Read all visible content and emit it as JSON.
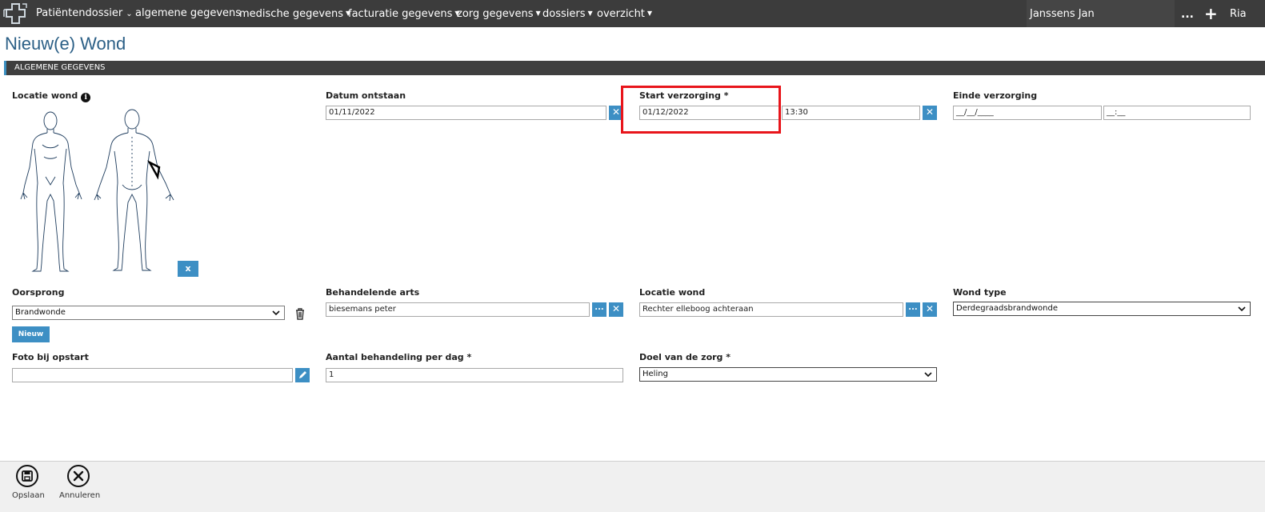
{
  "nav": {
    "brand": "Patiëntendossier",
    "items": [
      {
        "label": "algemene gegevens",
        "dropdown": false
      },
      {
        "label": "medische gegevens",
        "dropdown": true
      },
      {
        "label": "facturatie gegevens",
        "dropdown": true
      },
      {
        "label": "zorg gegevens",
        "dropdown": true
      },
      {
        "label": "dossiers",
        "dropdown": true
      },
      {
        "label": "overzicht",
        "dropdown": true
      }
    ],
    "patient_name": "Janssens Jan",
    "more_label": "...",
    "add_label": "+",
    "user": "Ria"
  },
  "page": {
    "title": "Nieuw(e) Wond",
    "section": "ALGEMENE GEGEVENS"
  },
  "form": {
    "locatie_wond_label": "Locatie wond",
    "body_clear_label": "x",
    "datum_ontstaan": {
      "label": "Datum ontstaan",
      "value": "01/11/2022"
    },
    "start_verzorging": {
      "label": "Start verzorging *",
      "date": "01/12/2022",
      "time": "13:30"
    },
    "einde_verzorging": {
      "label": "Einde verzorging",
      "date": "__/__/____",
      "time": "__:__"
    },
    "oorsprong": {
      "label": "Oorsprong",
      "value": "Brandwonde",
      "new_button": "Nieuw"
    },
    "behandelende_arts": {
      "label": "Behandelende arts",
      "value": "biesemans peter"
    },
    "locatie_wond2": {
      "label": "Locatie wond",
      "value": "Rechter elleboog achteraan"
    },
    "wond_type": {
      "label": "Wond type",
      "value": "Derdegraadsbrandwonde"
    },
    "foto": {
      "label": "Foto bij opstart",
      "value": ""
    },
    "aantal": {
      "label": "Aantal behandeling per dag *",
      "value": "1"
    },
    "doel": {
      "label": "Doel van de zorg *",
      "value": "Heling"
    },
    "clear_symbol": "✕",
    "browse_symbol": "..."
  },
  "footer": {
    "save_label": "Opslaan",
    "cancel_label": "Annuleren"
  },
  "colors": {
    "nav_bg": "#3c3c3c",
    "accent": "#3d8fc4",
    "title": "#2b5f86",
    "highlight": "#e8151b"
  }
}
